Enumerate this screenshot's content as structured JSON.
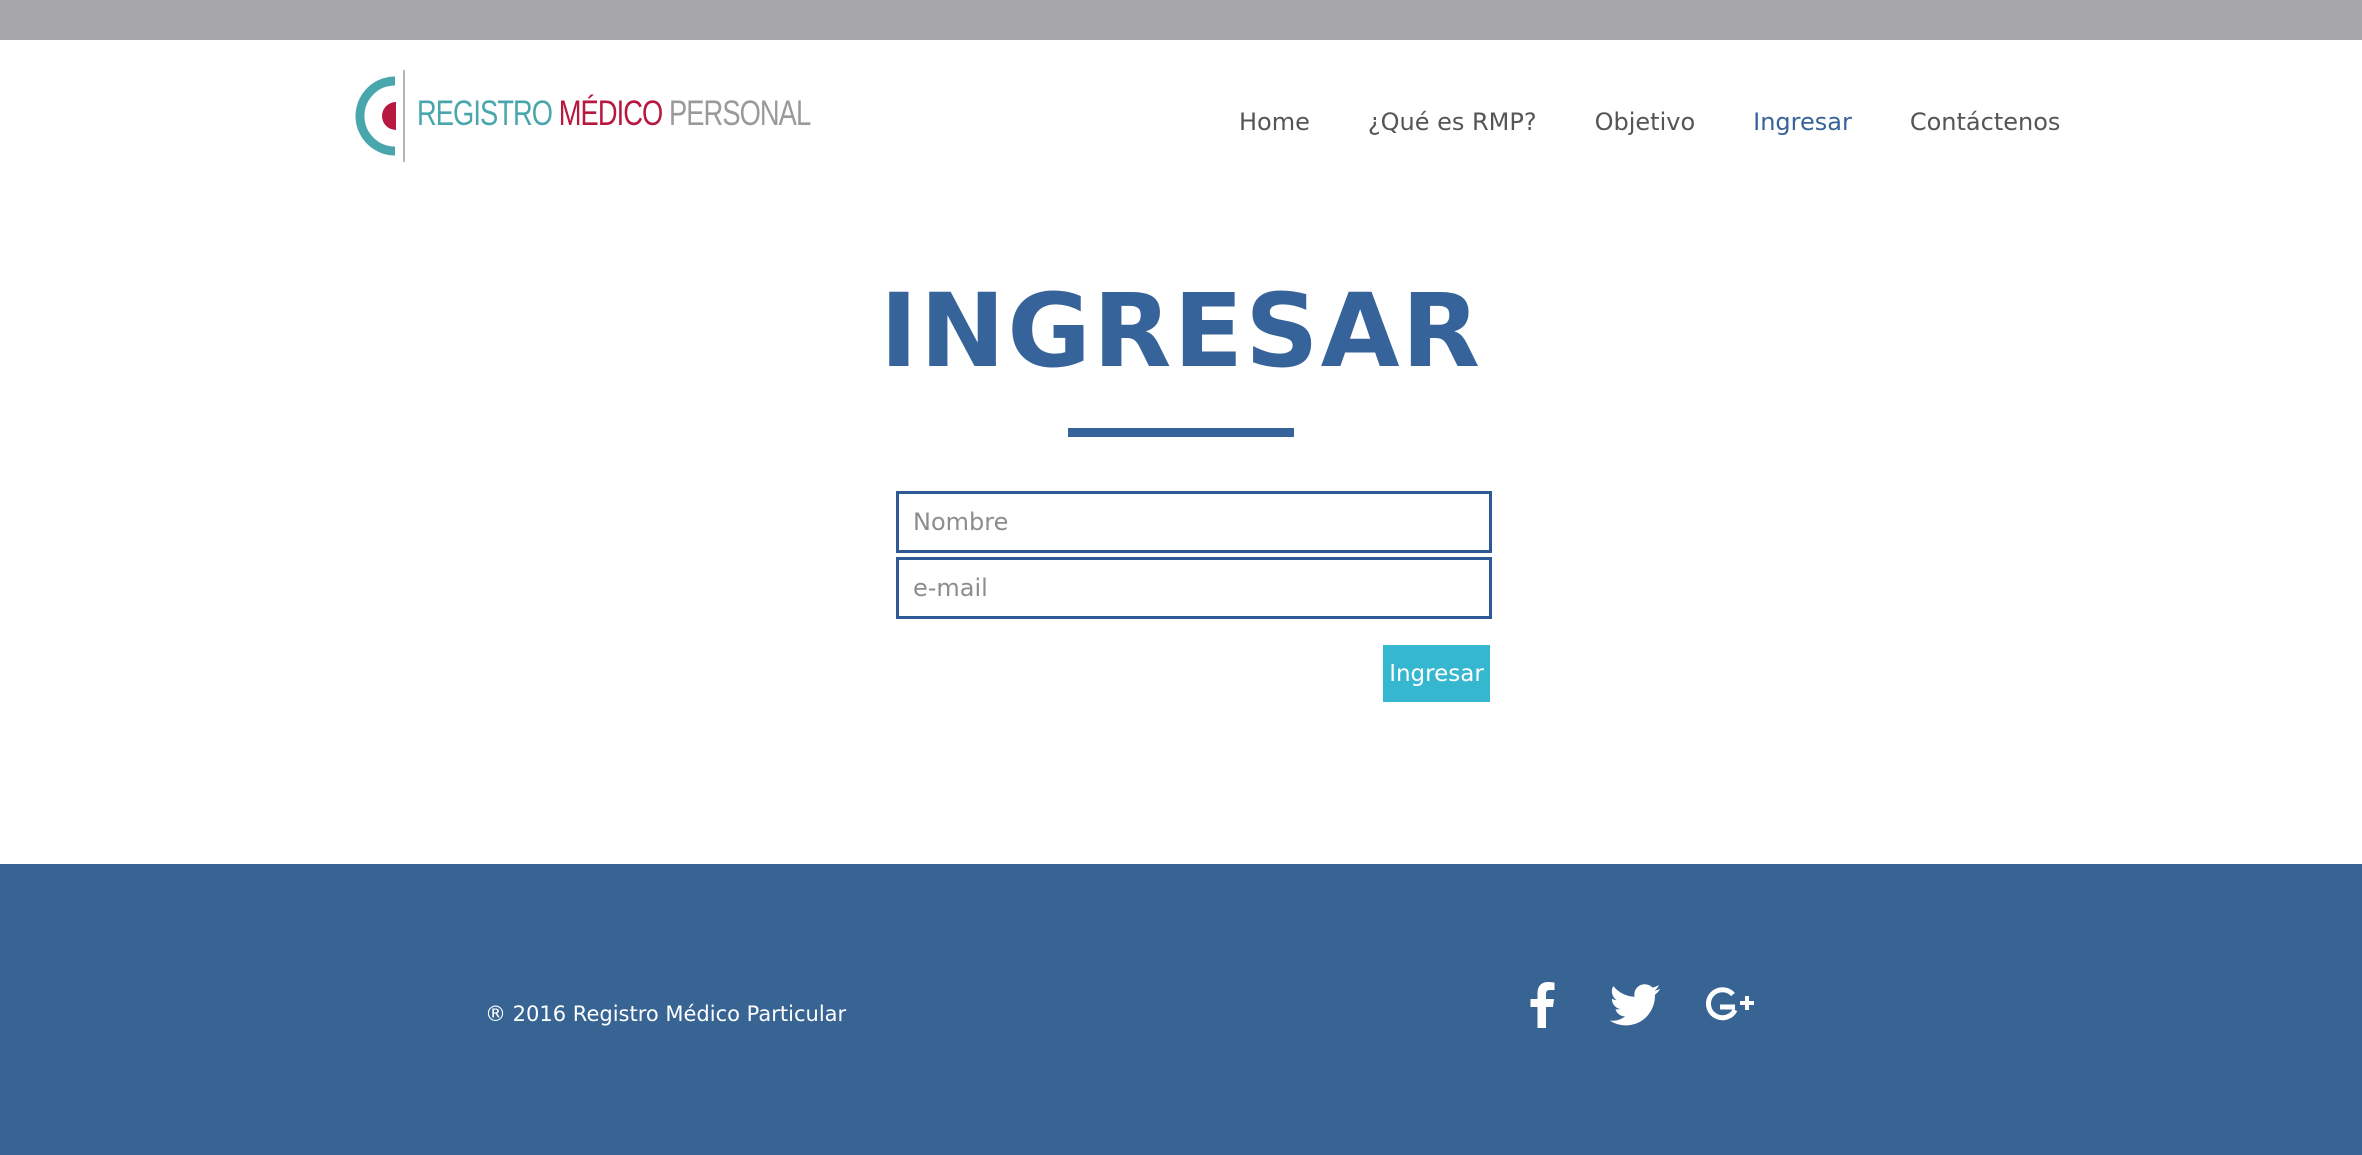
{
  "header": {
    "logo": {
      "word1": "REGISTRO",
      "word2": "MÉDICO",
      "word3": "PERSONAL"
    },
    "nav": [
      {
        "label": "Home",
        "active": false
      },
      {
        "label": "¿Qué es RMP?",
        "active": false
      },
      {
        "label": "Objetivo",
        "active": false
      },
      {
        "label": "Ingresar",
        "active": true
      },
      {
        "label": "Contáctenos",
        "active": false
      }
    ]
  },
  "main": {
    "title": "INGRESAR",
    "form": {
      "name_placeholder": "Nombre",
      "email_placeholder": "e-mail",
      "submit_label": "Ingresar"
    }
  },
  "footer": {
    "copyright": "® 2016 Registro Médico Particular",
    "social": [
      "facebook-icon",
      "twitter-icon",
      "google-plus-icon"
    ]
  },
  "colors": {
    "brand_blue": "#36639a",
    "accent_cyan": "#35b7cf",
    "logo_teal": "#4aa6ad",
    "logo_red": "#b8173f",
    "footer_bg": "#376493",
    "topbar_gray": "#a7a7a9"
  }
}
